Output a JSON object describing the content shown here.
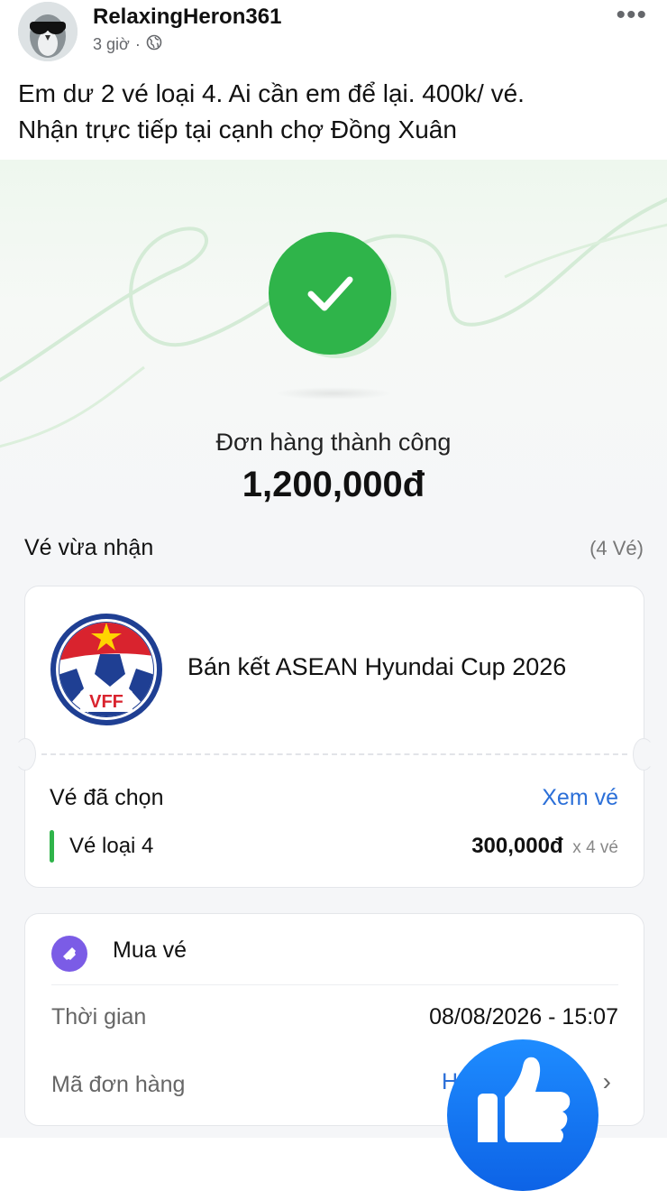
{
  "post": {
    "username": "RelaxingHeron361",
    "time": "3 giờ",
    "dot": "·",
    "more_icon": "more-horizontal-icon",
    "text_line1": "Em dư 2 vé loại 4. Ai cần em để lại. 400k/ vé.",
    "text_line2": "Nhận trực tiếp tại cạnh chợ Đồng Xuân"
  },
  "receipt": {
    "status": "Đơn hàng thành công",
    "total": "1,200,000đ",
    "section_title": "Vé vừa nhận",
    "section_count": "(4 Vé)",
    "logo_text": "VFF",
    "match_name": "Bán kết ASEAN Hyundai Cup 2026",
    "selected_label": "Vé đã chọn",
    "view_link": "Xem vé",
    "ticket_type": "Vé loại 4",
    "ticket_price": "300,000đ",
    "ticket_qty": "x 4 vé",
    "buy_title": "Mua vé",
    "time_label": "Thời gian",
    "time_value": "08/08/2026 - 15:07",
    "code_label": "Mã đơn hàng",
    "code_peek": "H",
    "chevron": "›"
  },
  "colors": {
    "success_green": "#2fb44a",
    "link_blue": "#2b6fd8",
    "purple": "#7b5ce6",
    "like_blue": "#1877f2"
  },
  "icons": [
    "avatar",
    "globe-icon",
    "more-horizontal-icon",
    "checkmark-icon",
    "vff-logo",
    "ticket-icon",
    "chevron-right-icon",
    "like-icon"
  ]
}
